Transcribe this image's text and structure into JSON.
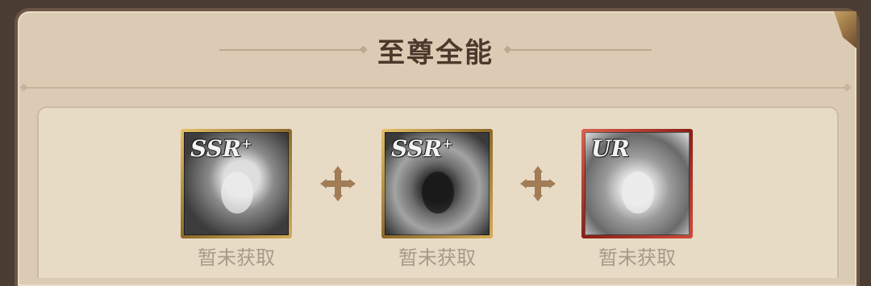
{
  "title": "至尊全能",
  "slots": [
    {
      "rank": "SSR",
      "rank_sup": "+",
      "status": "暂未获取",
      "portrait_icon": "female-hero-portrait-icon"
    },
    {
      "rank": "SSR",
      "rank_sup": "+",
      "status": "暂未获取",
      "portrait_icon": "armored-demon-portrait-icon"
    },
    {
      "rank": "UR",
      "rank_sup": "",
      "status": "暂未获取",
      "portrait_icon": "crowned-female-portrait-icon"
    }
  ],
  "colors": {
    "panel_bg": "#dccbb4",
    "title_color": "#4b3a2c",
    "plus_color": "#a17c55",
    "status_color": "#a89a8a",
    "ssr_frame": "#c9a24f",
    "ur_frame": "#b7372a"
  }
}
